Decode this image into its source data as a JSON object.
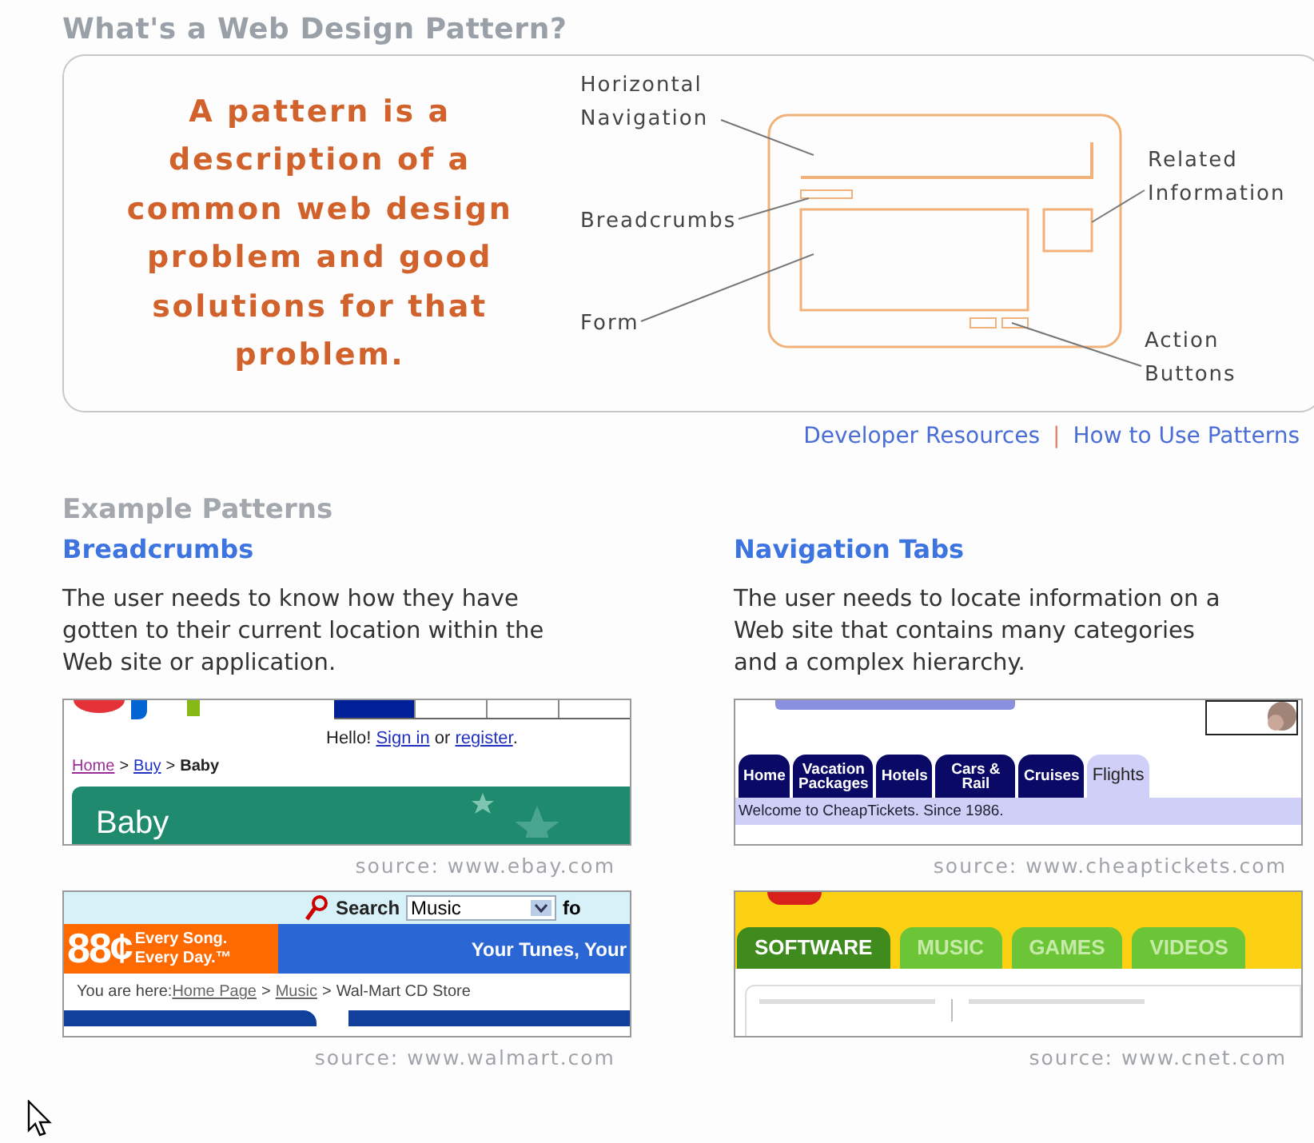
{
  "title": "What's a Web Design Pattern?",
  "intro": {
    "statement": "A pattern is a description of a common web design problem and good solutions for that problem.",
    "labels": [
      {
        "kind": "nav",
        "lines": [
          "Horizontal",
          "Navigation"
        ]
      },
      {
        "kind": "crumbs",
        "lines": [
          "Breadcrumbs"
        ]
      },
      {
        "kind": "form",
        "lines": [
          "Form"
        ]
      },
      {
        "kind": "related",
        "lines": [
          "Related",
          "Information"
        ]
      },
      {
        "kind": "actions",
        "lines": [
          "Action",
          "Buttons"
        ]
      }
    ]
  },
  "links": {
    "items": [
      "Developer Resources",
      "How to Use Patterns"
    ],
    "separator": "|"
  },
  "section_title": "Example Patterns",
  "patterns": [
    {
      "title": "Breadcrumbs",
      "description": "The user needs to know how they have gotten to their current location within the Web site or application.",
      "examples": [
        {
          "kind": "ebay",
          "greeting": {
            "lead": "Hello!",
            "sign_in": "Sign in",
            "joiner": "or",
            "register": "register",
            "end": "."
          },
          "crumbs": [
            {
              "label": "Home",
              "link": true
            },
            {
              "label": "Buy",
              "link": true
            },
            {
              "label": "Baby",
              "link": false
            }
          ],
          "crumb_separator": ">",
          "banner": "Baby",
          "source": "source: www.ebay.com"
        },
        {
          "kind": "walmart",
          "search_label": "Search",
          "search_value": "Music",
          "cut_text": "fo",
          "price": "88¢",
          "slogan": [
            "Every Song.",
            "Every Day.™"
          ],
          "banner": "Your Tunes, Your",
          "here": "You are here:",
          "crumbs": [
            {
              "label": "Home Page",
              "link": true
            },
            {
              "label": "Music",
              "link": true
            },
            {
              "label": "Wal-Mart CD Store",
              "link": false
            }
          ],
          "crumb_separator": ">",
          "source": "source: www.walmart.com"
        }
      ]
    },
    {
      "title": "Navigation Tabs",
      "description": "The user needs to locate information on a Web site that contains many categories and a complex hierarchy.",
      "examples": [
        {
          "kind": "cheaptickets",
          "tabs": [
            {
              "label": "Home",
              "selected": false
            },
            {
              "label": "Vacation Packages",
              "selected": false
            },
            {
              "label": "Hotels",
              "selected": false
            },
            {
              "label": "Cars & Rail",
              "selected": false
            },
            {
              "label": "Cruises",
              "selected": false
            },
            {
              "label": "Flights",
              "selected": true
            }
          ],
          "welcome": "Welcome to CheapTickets. Since 1986.",
          "source": "source: www.cheaptickets.com"
        },
        {
          "kind": "cnet",
          "tabs": [
            {
              "label": "SOFTWARE",
              "selected": true
            },
            {
              "label": "MUSIC",
              "selected": false
            },
            {
              "label": "GAMES",
              "selected": false
            },
            {
              "label": "VIDEOS",
              "selected": false
            }
          ],
          "source": "source: www.cnet.com"
        }
      ]
    }
  ]
}
